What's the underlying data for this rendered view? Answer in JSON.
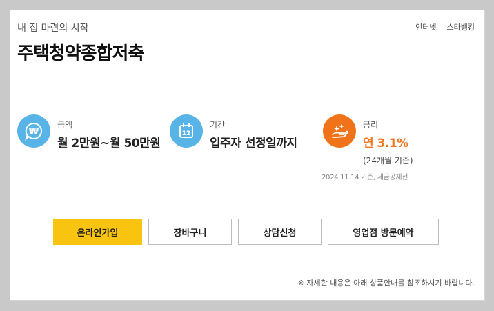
{
  "header": {
    "subtitle": "내 집 마련의 시작",
    "title": "주택청약종합저축",
    "links": [
      "인터넷",
      "스타뱅킹"
    ]
  },
  "info": [
    {
      "icon": "won-speech-bubble-icon",
      "label": "금액",
      "value": "월 2만원~월 50만원"
    },
    {
      "icon": "calendar-12-icon",
      "label": "기간",
      "value": "입주자 선정일까지"
    },
    {
      "icon": "hand-sparkle-icon",
      "label": "금리",
      "value": "연 3.1%",
      "sub": "(24개월 기준)"
    }
  ],
  "note": "2024.11.14 기준, 세금공제전",
  "buttons": {
    "online_join": "온라인가입",
    "cart": "장바구니",
    "consult": "상담신청",
    "branch_visit": "영업점 방문예약"
  },
  "footnote": "※ 자세한 내용은 아래 상품안내를 참조하시기 바랍니다.",
  "colors": {
    "accent_blue": "#58b4e6",
    "accent_orange": "#f0731a",
    "primary_button": "#f9c40f"
  }
}
